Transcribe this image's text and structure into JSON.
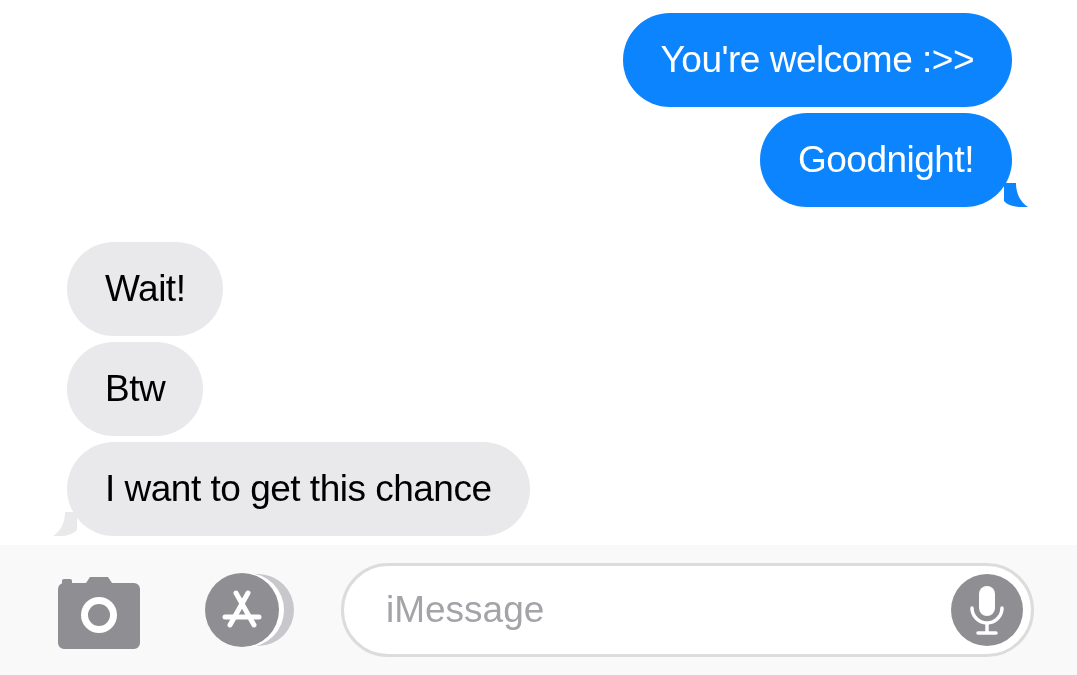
{
  "messages": [
    {
      "text": "You're welcome :>>",
      "kind": "sent",
      "tail": false
    },
    {
      "text": "Goodnight!",
      "kind": "sent",
      "tail": true
    },
    {
      "text": "Wait!",
      "kind": "received",
      "tail": false
    },
    {
      "text": "Btw",
      "kind": "received",
      "tail": false
    },
    {
      "text": "I want to get this chance",
      "kind": "received",
      "tail": true
    }
  ],
  "composer": {
    "placeholder": "iMessage"
  }
}
